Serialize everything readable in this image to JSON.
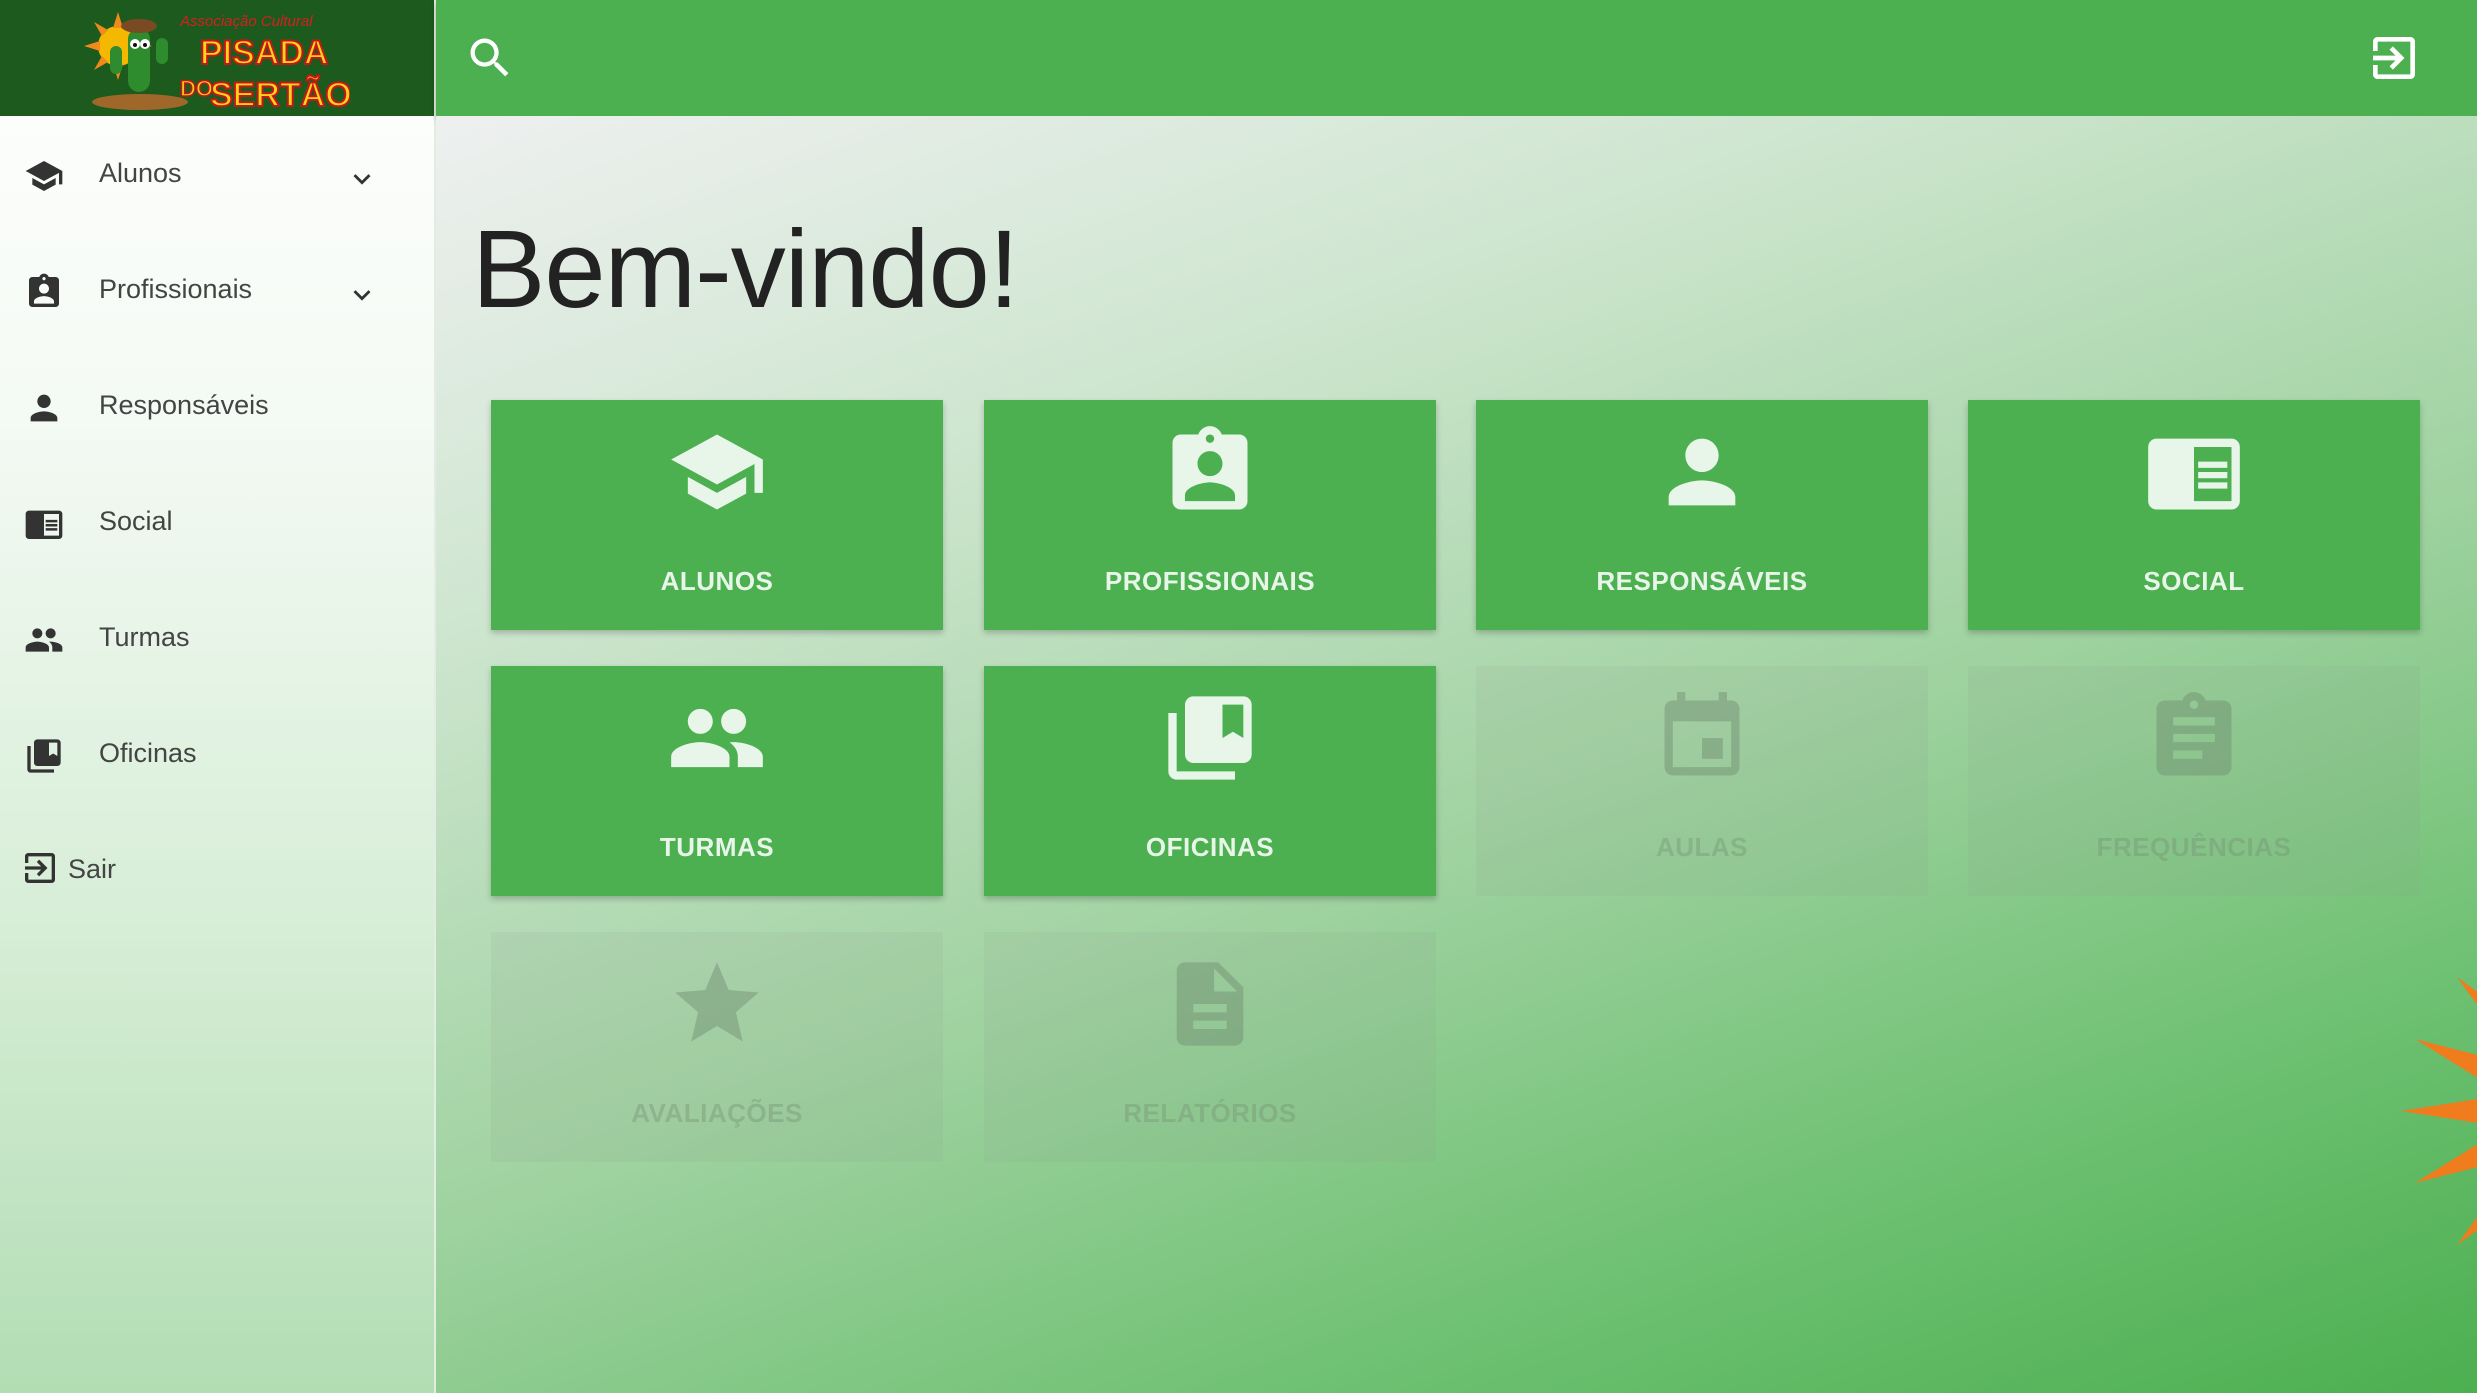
{
  "brand": {
    "logo_text_small": "Associação Cultural",
    "logo_text_line1": "PISADA",
    "logo_text_line2_a": "DO",
    "logo_text_line2_b": "SERTÃO"
  },
  "sidebar": {
    "items": [
      {
        "label": "Alunos",
        "icon": "graduation-cap-icon",
        "expandable": true
      },
      {
        "label": "Profissionais",
        "icon": "badge-icon",
        "expandable": true
      },
      {
        "label": "Responsáveis",
        "icon": "person-icon",
        "expandable": false
      },
      {
        "label": "Social",
        "icon": "newspaper-icon",
        "expandable": false
      },
      {
        "label": "Turmas",
        "icon": "group-icon",
        "expandable": false
      },
      {
        "label": "Oficinas",
        "icon": "library-books-icon",
        "expandable": false
      },
      {
        "label": "Sair",
        "icon": "exit-icon",
        "expandable": false
      }
    ]
  },
  "topbar": {
    "search_icon": "search-icon",
    "exit_icon": "exit-icon",
    "color": "#4caf50"
  },
  "main": {
    "welcome": "Bem-vindo!",
    "tiles": [
      {
        "label": "ALUNOS",
        "icon": "graduation-cap-icon",
        "enabled": true
      },
      {
        "label": "PROFISSIONAIS",
        "icon": "badge-icon",
        "enabled": true
      },
      {
        "label": "RESPONSÁVEIS",
        "icon": "person-icon",
        "enabled": true
      },
      {
        "label": "SOCIAL",
        "icon": "newspaper-icon",
        "enabled": true
      },
      {
        "label": "TURMAS",
        "icon": "group-icon",
        "enabled": true
      },
      {
        "label": "OFICINAS",
        "icon": "library-books-icon",
        "enabled": true
      },
      {
        "label": "AULAS",
        "icon": "calendar-icon",
        "enabled": false
      },
      {
        "label": "FREQUÊNCIAS",
        "icon": "clipboard-icon",
        "enabled": false
      },
      {
        "label": "AVALIAÇÕES",
        "icon": "star-icon",
        "enabled": false
      },
      {
        "label": "RELATÓRIOS",
        "icon": "document-icon",
        "enabled": false
      }
    ]
  },
  "colors": {
    "primary": "#4caf50",
    "logo_bg": "#1d5a1d",
    "tile_text": "#e8f5e9"
  }
}
